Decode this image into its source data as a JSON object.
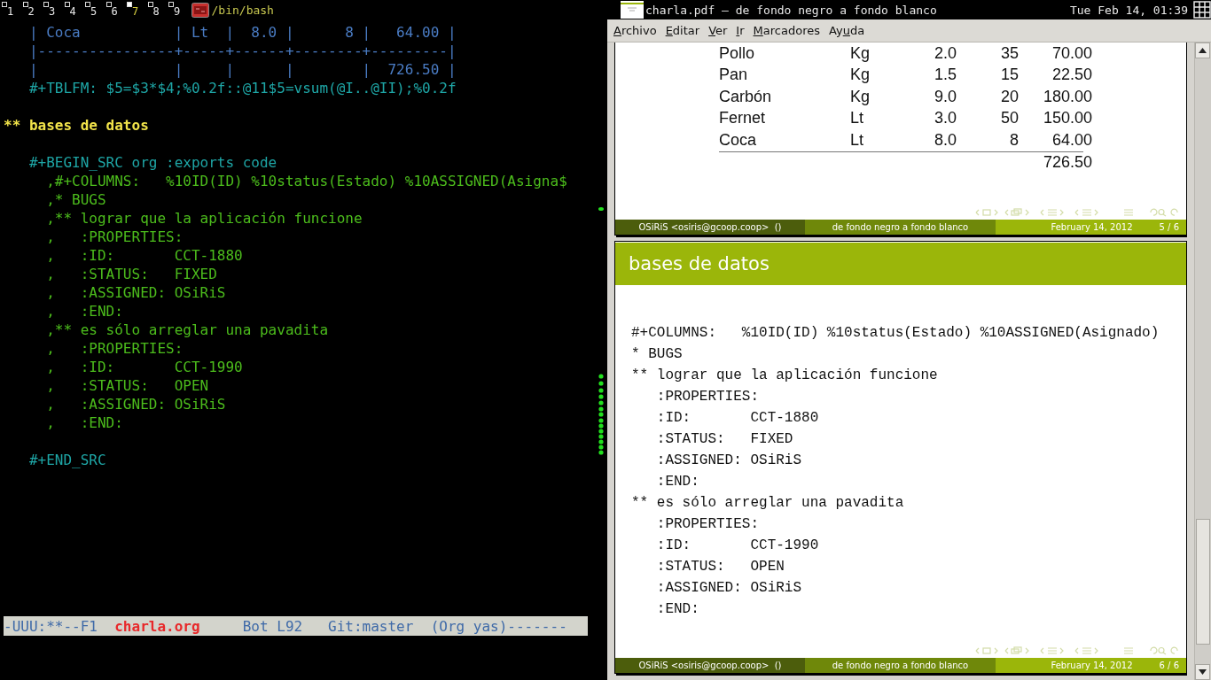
{
  "workspaces": [
    {
      "label": "1",
      "selected": false
    },
    {
      "label": "2",
      "selected": false
    },
    {
      "label": "3",
      "selected": false
    },
    {
      "label": "4",
      "selected": false
    },
    {
      "label": "5",
      "selected": false
    },
    {
      "label": "6",
      "selected": false
    },
    {
      "label": "7",
      "selected": true
    },
    {
      "label": "8",
      "selected": false
    },
    {
      "label": "9",
      "selected": false
    }
  ],
  "terminal_title": "/bin/bash",
  "editor": {
    "lines": [
      {
        "kind": "table",
        "text": "   | Coca           | Lt  |  8.0 |      8 |   64.00 |"
      },
      {
        "kind": "table",
        "text": "   |----------------+-----+------+--------+---------|"
      },
      {
        "kind": "table",
        "text": "   |                |     |      |        |  726.50 |"
      },
      {
        "kind": "formula",
        "text": "   #+TBLFM: $5=$3*$4;%0.2f::@11$5=vsum(@I..@II);%0.2f"
      },
      {
        "kind": "blank"
      },
      {
        "kind": "heading",
        "text": "** bases de datos"
      },
      {
        "kind": "blank"
      },
      {
        "kind": "src",
        "text": "   #+BEGIN_SRC org :exports code"
      },
      {
        "kind": "code",
        "text": "     ,#+COLUMNS:   %10ID(ID) %10status(Estado) %10ASSIGNED(Asigna$"
      },
      {
        "kind": "code",
        "text": "     ,* BUGS"
      },
      {
        "kind": "code",
        "text": "     ,** lograr que la aplicación funcione"
      },
      {
        "kind": "code",
        "text": "     ,   :PROPERTIES:"
      },
      {
        "kind": "code",
        "text": "     ,   :ID:       CCT-1880"
      },
      {
        "kind": "code",
        "text": "     ,   :STATUS:   FIXED"
      },
      {
        "kind": "code",
        "text": "     ,   :ASSIGNED: OSiRiS"
      },
      {
        "kind": "code",
        "text": "     ,   :END:"
      },
      {
        "kind": "code",
        "text": "     ,** es sólo arreglar una pavadita"
      },
      {
        "kind": "code",
        "text": "     ,   :PROPERTIES:"
      },
      {
        "kind": "code",
        "text": "     ,   :ID:       CCT-1990"
      },
      {
        "kind": "code",
        "text": "     ,   :STATUS:   OPEN"
      },
      {
        "kind": "code",
        "text": "     ,   :ASSIGNED: OSiRiS"
      },
      {
        "kind": "code",
        "text": "     ,   :END:"
      },
      {
        "kind": "blank"
      },
      {
        "kind": "src",
        "text": "   #+END_SRC"
      }
    ],
    "mode_line": {
      "flags": "-UUU:**--F1",
      "buffer": "charla.org",
      "position": "Bot L92",
      "branch": "Git:master",
      "modes": "(Org yas)-------"
    }
  },
  "viewer": {
    "title": "charla.pdf — de fondo negro a fondo blanco",
    "clock": "Tue Feb 14, 01:39",
    "menu": [
      {
        "key": "A",
        "post": "rchivo"
      },
      {
        "key": "E",
        "post": "ditar"
      },
      {
        "key": "V",
        "post": "er"
      },
      {
        "key": "I",
        "post": "r"
      },
      {
        "key": "M",
        "post": "arcadores"
      },
      {
        "pre": "Ay",
        "key": "u",
        "post": "da"
      }
    ],
    "pages": [
      {
        "kind": "table",
        "rows": [
          [
            "Pollo",
            "Kg",
            "2.0",
            "35",
            "70.00"
          ],
          [
            "Pan",
            "Kg",
            "1.5",
            "15",
            "22.50"
          ],
          [
            "Carbón",
            "Kg",
            "9.0",
            "20",
            "180.00"
          ],
          [
            "Fernet",
            "Lt",
            "3.0",
            "50",
            "150.00"
          ],
          [
            "Coca",
            "Lt",
            "8.0",
            "8",
            "64.00"
          ]
        ],
        "total": "726.50",
        "footer": {
          "author": "OSiRiS <osiris@gcoop.coop>  ()",
          "title": "de fondo negro a fondo blanco",
          "date": "February 14, 2012",
          "page": "5 / 6"
        }
      },
      {
        "kind": "code",
        "heading": "bases de datos",
        "lines": [
          "#+COLUMNS:   %10ID(ID) %10status(Estado) %10ASSIGNED(Asignado)",
          "* BUGS",
          "** lograr que la aplicación funcione",
          "   :PROPERTIES:",
          "   :ID:       CCT-1880",
          "   :STATUS:   FIXED",
          "   :ASSIGNED: OSiRiS",
          "   :END:",
          "** es sólo arreglar una pavadita",
          "   :PROPERTIES:",
          "   :ID:       CCT-1990",
          "   :STATUS:   OPEN",
          "   :ASSIGNED: OSiRiS",
          "   :END:"
        ],
        "footer": {
          "author": "OSiRiS <osiris@gcoop.coop>  ()",
          "title": "de fondo negro a fondo blanco",
          "date": "February 14, 2012",
          "page": "6 / 6"
        }
      }
    ]
  }
}
